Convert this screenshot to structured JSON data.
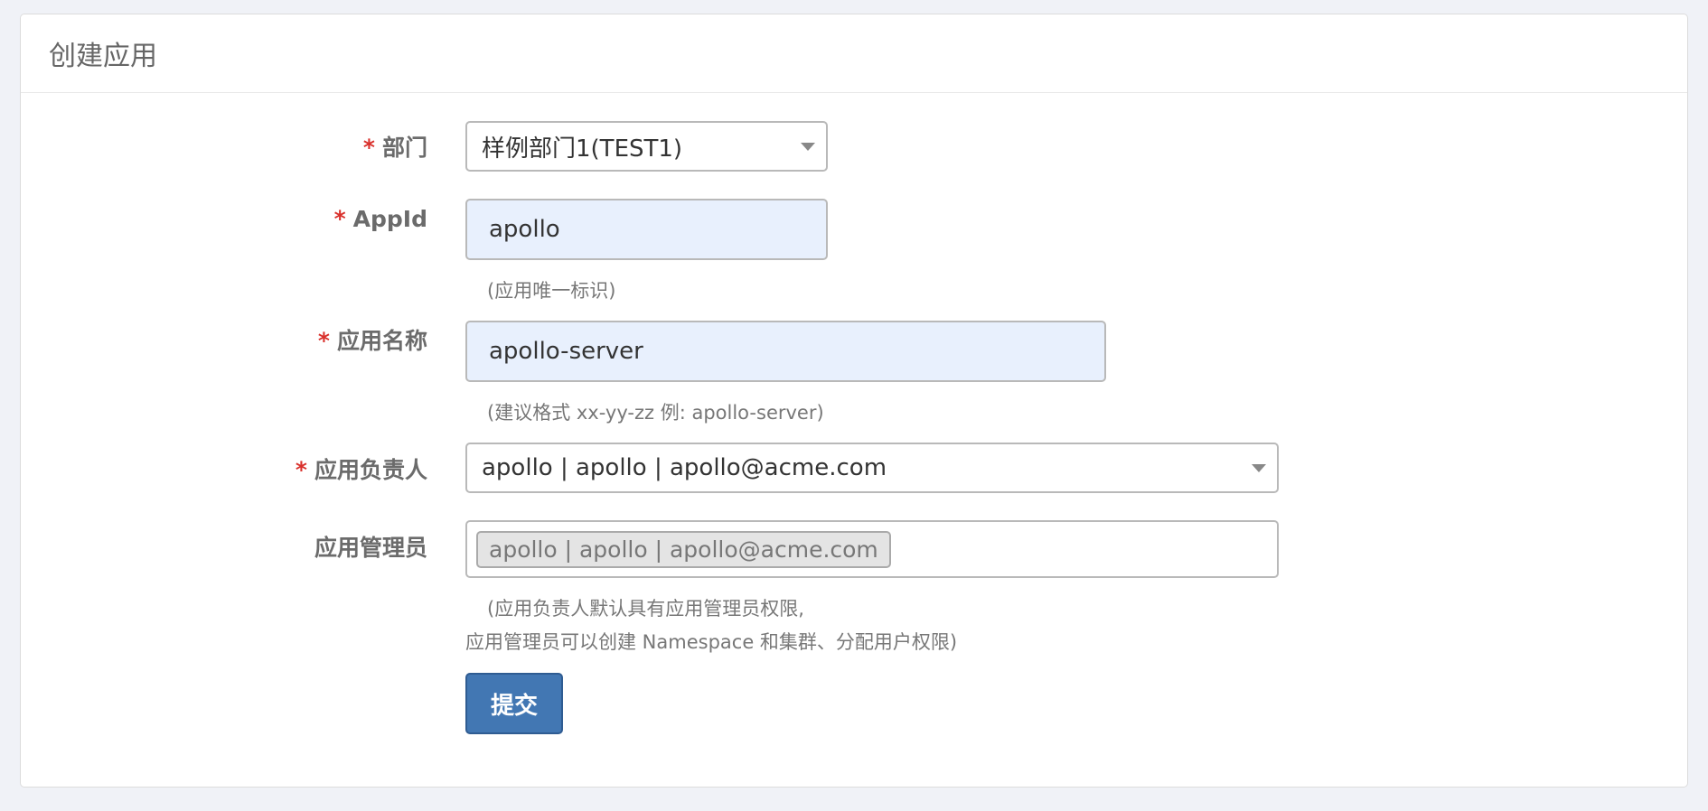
{
  "panel": {
    "title": "创建应用"
  },
  "form": {
    "required_mark": "*",
    "department": {
      "label": "部门",
      "value": "样例部门1(TEST1)"
    },
    "appid": {
      "label": "AppId",
      "value": "apollo",
      "help": "(应用唯一标识)"
    },
    "app_name": {
      "label": "应用名称",
      "value": "apollo-server",
      "help": "(建议格式 xx-yy-zz 例: apollo-server)"
    },
    "owner": {
      "label": "应用负责人",
      "value": "apollo | apollo | apollo@acme.com"
    },
    "admins": {
      "label": "应用管理员",
      "tags": [
        "apollo | apollo | apollo@acme.com"
      ],
      "help_line1": "(应用负责人默认具有应用管理员权限,",
      "help_line2": "应用管理员可以创建 Namespace 和集群、分配用户权限)"
    },
    "submit_label": "提交"
  },
  "colors": {
    "primary": "#4277b3",
    "required": "#d9312c",
    "autofill": "#e8f0fd"
  }
}
